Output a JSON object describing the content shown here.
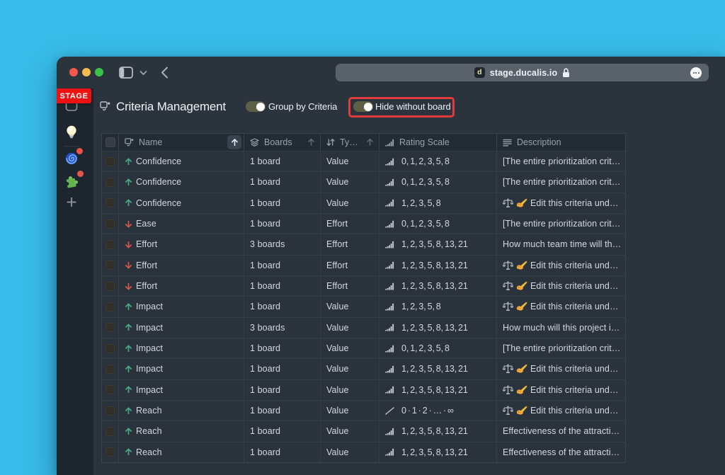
{
  "colors": {
    "desktop_background": "#38bce9",
    "window_background": "#2b333d",
    "sidebar_background": "#1d252e",
    "table_header_background": "#232b34",
    "stage_badge_red": "#ef1012",
    "annotation_red": "#e23b3b",
    "toggle_track_olive": "#5d6046",
    "trend_up_green": "#4aa983",
    "trend_down_red": "#d4574d"
  },
  "browser": {
    "url": "stage.ducalis.io",
    "favicon_letter": "d",
    "traffic_lights": [
      "close",
      "minimize",
      "zoom"
    ],
    "toolbar_icons": [
      "sidebar-toggle",
      "chevron-down",
      "back"
    ],
    "lock_icon": "lock",
    "more_button": "ellipsis"
  },
  "stage_badge": "STAGE",
  "sidebar": {
    "icons": [
      {
        "name": "boards-box"
      },
      {
        "name": "lightbulb"
      },
      {
        "name": "cyclone",
        "notification": true
      },
      {
        "name": "puzzle",
        "notification": true
      },
      {
        "name": "add-plus"
      }
    ]
  },
  "header": {
    "title": "Criteria Management",
    "toggles": [
      {
        "label": "Group by Criteria",
        "on": true,
        "highlighted": false
      },
      {
        "label": "Hide without board",
        "on": true,
        "highlighted": true
      }
    ]
  },
  "table": {
    "columns": [
      {
        "key": "select",
        "label": ""
      },
      {
        "key": "name",
        "label": "Name",
        "icon": "criteria-icon",
        "sort": "active-asc"
      },
      {
        "key": "boards",
        "label": "Boards",
        "icon": "layers-icon",
        "sort": "asc"
      },
      {
        "key": "type",
        "label": "Ty…",
        "icon": "sort-updown-icon",
        "sort": "asc"
      },
      {
        "key": "rating",
        "label": "Rating Scale",
        "icon": "bars-icon",
        "sort": null
      },
      {
        "key": "description",
        "label": "Description",
        "icon": "lines-icon",
        "sort": null
      }
    ],
    "rows": [
      {
        "trend": "up",
        "name": "Confidence",
        "boards": "1 board",
        "type": "Value",
        "scale_icon": "bars",
        "scale": "0, 1, 2, 3, 5, 8",
        "desc_emoji": false,
        "description": "[The entire prioritization crit…"
      },
      {
        "trend": "up",
        "name": "Confidence",
        "boards": "1 board",
        "type": "Value",
        "scale_icon": "bars",
        "scale": "0, 1, 2, 3, 5, 8",
        "desc_emoji": false,
        "description": "[The entire prioritization crit…"
      },
      {
        "trend": "up",
        "name": "Confidence",
        "boards": "1 board",
        "type": "Value",
        "scale_icon": "bars",
        "scale": "1, 2, 3, 5, 8",
        "desc_emoji": true,
        "description": "Edit this criteria und…"
      },
      {
        "trend": "down",
        "name": "Ease",
        "boards": "1 board",
        "type": "Effort",
        "scale_icon": "bars",
        "scale": "0, 1, 2, 3, 5, 8",
        "desc_emoji": false,
        "description": "[The entire prioritization crit…"
      },
      {
        "trend": "down",
        "name": "Effort",
        "boards": "3 boards",
        "type": "Effort",
        "scale_icon": "bars",
        "scale": "1, 2, 3, 5, 8, 13, 21",
        "desc_emoji": false,
        "description": "How much team time will th…"
      },
      {
        "trend": "down",
        "name": "Effort",
        "boards": "1 board",
        "type": "Effort",
        "scale_icon": "bars",
        "scale": "1, 2, 3, 5, 8, 13, 21",
        "desc_emoji": true,
        "description": "Edit this criteria und…"
      },
      {
        "trend": "down",
        "name": "Effort",
        "boards": "1 board",
        "type": "Effort",
        "scale_icon": "bars",
        "scale": "1, 2, 3, 5, 8, 13, 21",
        "desc_emoji": true,
        "description": "Edit this criteria und…"
      },
      {
        "trend": "up",
        "name": "Impact",
        "boards": "1 board",
        "type": "Value",
        "scale_icon": "bars",
        "scale": "1, 2, 3, 5, 8",
        "desc_emoji": true,
        "description": "Edit this criteria und…"
      },
      {
        "trend": "up",
        "name": "Impact",
        "boards": "3 boards",
        "type": "Value",
        "scale_icon": "bars",
        "scale": "1, 2, 3, 5, 8, 13, 21",
        "desc_emoji": false,
        "description": "How much will this project i…"
      },
      {
        "trend": "up",
        "name": "Impact",
        "boards": "1 board",
        "type": "Value",
        "scale_icon": "bars",
        "scale": "0, 1, 2, 3, 5, 8",
        "desc_emoji": false,
        "description": "[The entire prioritization crit…"
      },
      {
        "trend": "up",
        "name": "Impact",
        "boards": "1 board",
        "type": "Value",
        "scale_icon": "bars",
        "scale": "1, 2, 3, 5, 8, 13, 21",
        "desc_emoji": true,
        "description": "Edit this criteria und…"
      },
      {
        "trend": "up",
        "name": "Impact",
        "boards": "1 board",
        "type": "Value",
        "scale_icon": "bars",
        "scale": "1, 2, 3, 5, 8, 13, 21",
        "desc_emoji": true,
        "description": "Edit this criteria und…"
      },
      {
        "trend": "up",
        "name": "Reach",
        "boards": "1 board",
        "type": "Value",
        "scale_icon": "line",
        "scale": "0 · 1 · 2 · … · ∞",
        "desc_emoji": true,
        "description": "Edit this criteria und…"
      },
      {
        "trend": "up",
        "name": "Reach",
        "boards": "1 board",
        "type": "Value",
        "scale_icon": "bars",
        "scale": "1, 2, 3, 5, 8, 13, 21",
        "desc_emoji": false,
        "description": "Effectiveness of the attracti…"
      },
      {
        "trend": "up",
        "name": "Reach",
        "boards": "1 board",
        "type": "Value",
        "scale_icon": "bars",
        "scale": "1, 2, 3, 5, 8, 13, 21",
        "desc_emoji": false,
        "description": "Effectiveness of the attracti…"
      }
    ]
  }
}
